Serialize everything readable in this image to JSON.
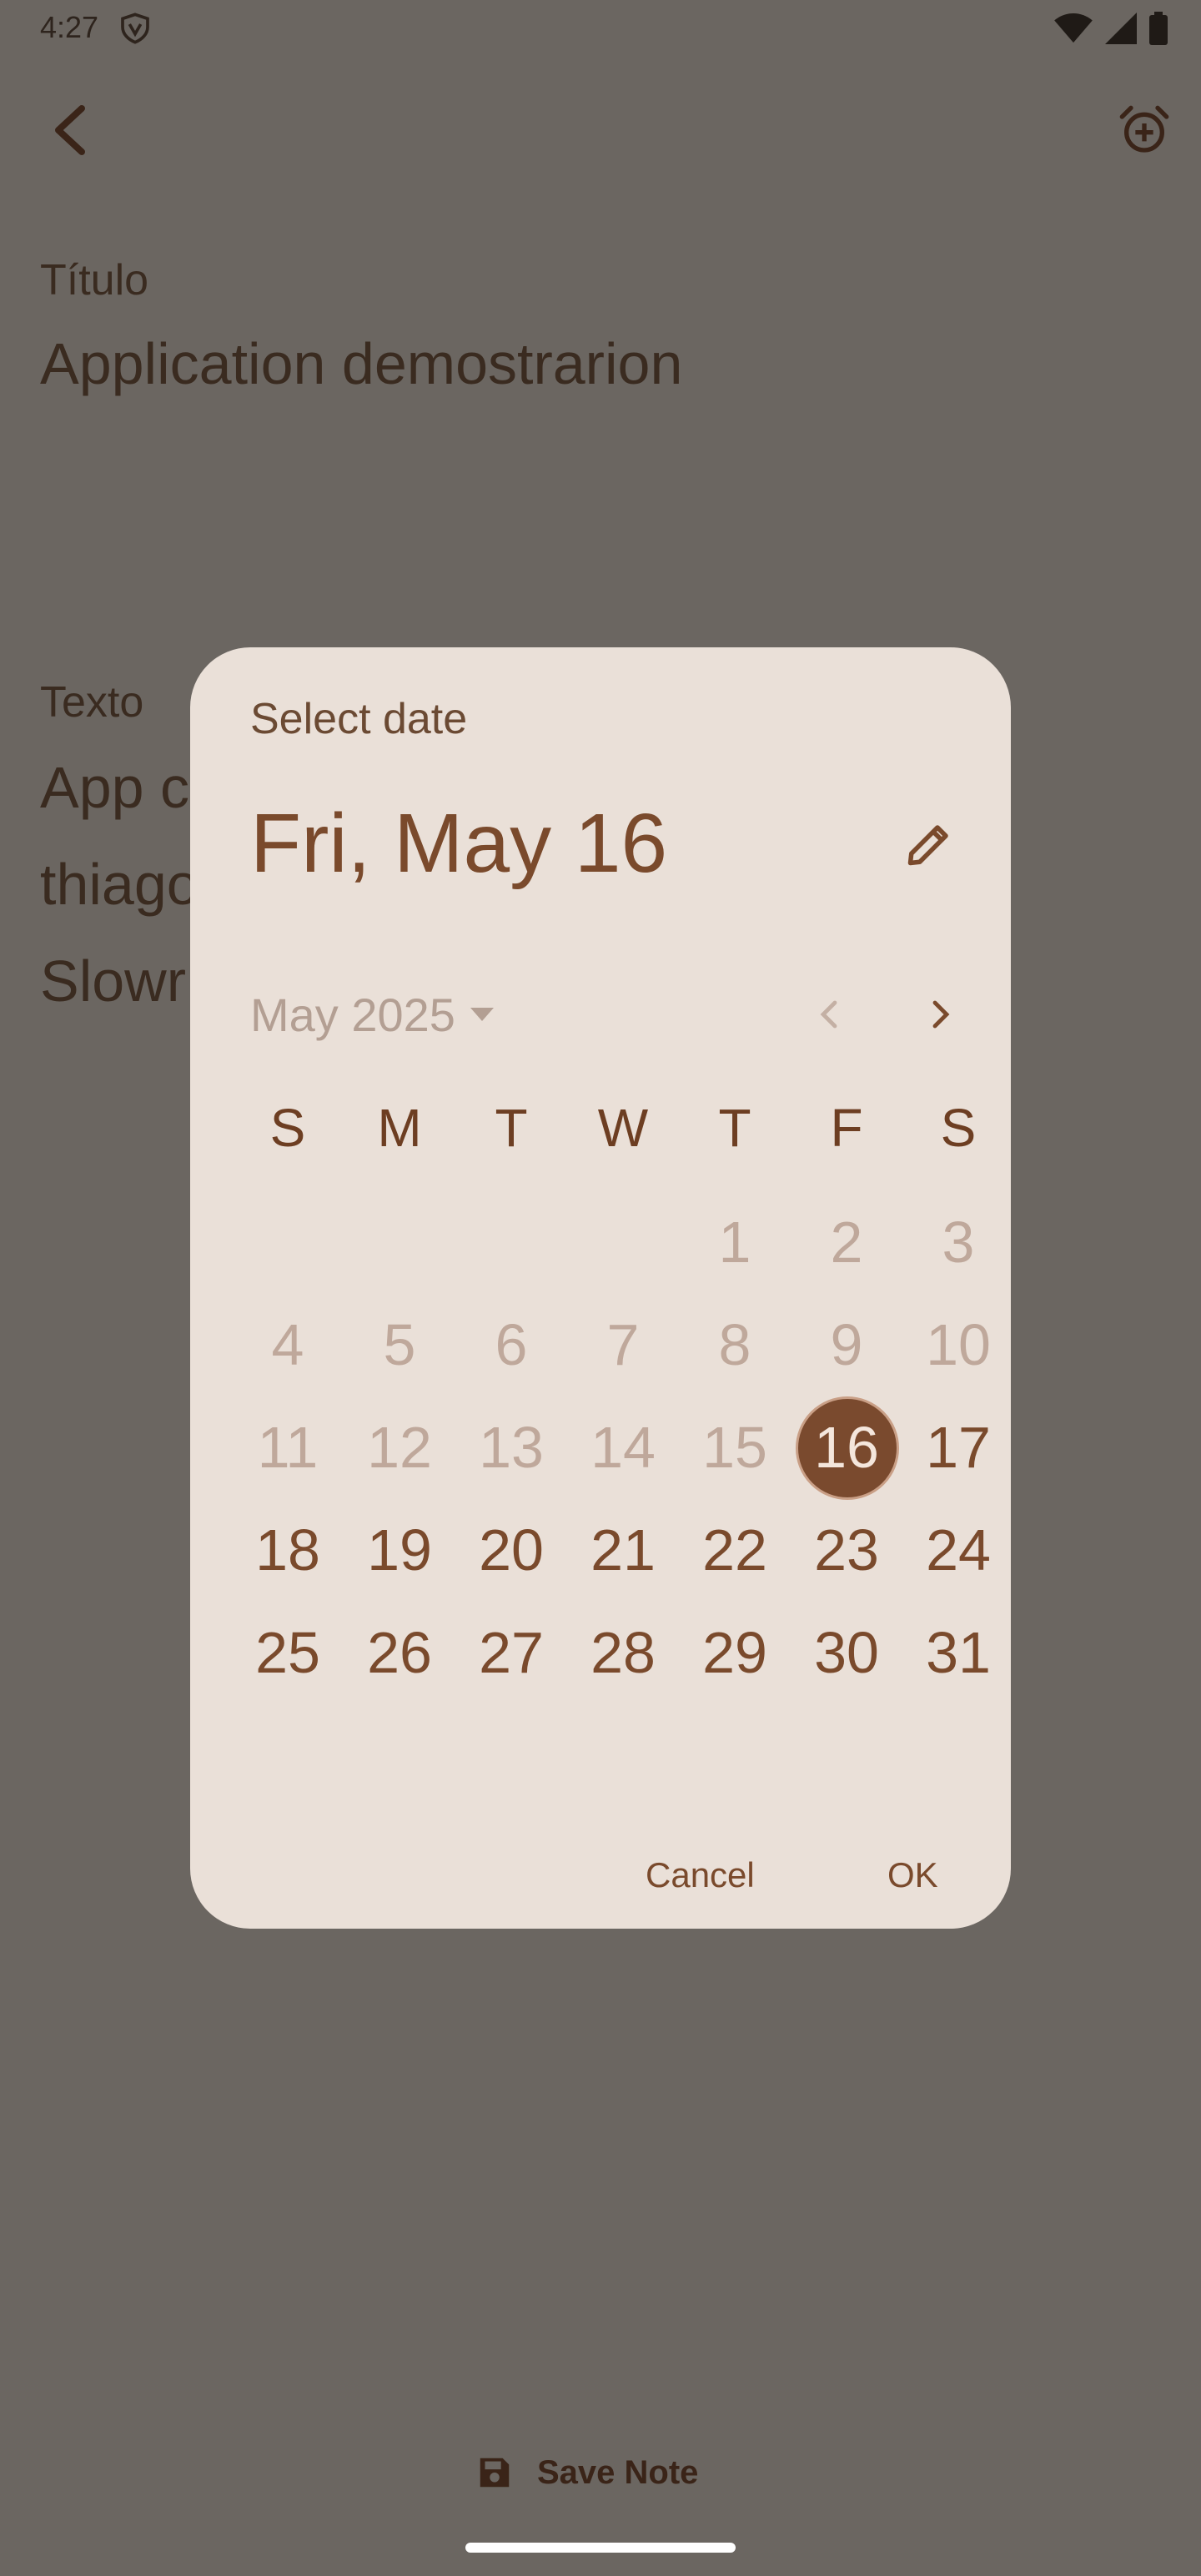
{
  "status_bar": {
    "time": "4:27",
    "icons": [
      "vpn-icon",
      "wifi-icon",
      "cell-signal-icon",
      "battery-icon"
    ]
  },
  "app_bar": {
    "back_icon": "chevron-left-icon",
    "alarm_icon": "alarm-add-icon"
  },
  "note": {
    "title_label": "Título",
    "title_value": "Application demostrarion",
    "body_label": "Texto",
    "body_value": "App c\nthiago\nSlowr"
  },
  "date_picker": {
    "heading": "Select date",
    "selected_date": "Fri, May 16",
    "edit_icon": "pencil-icon",
    "month_year": "May 2025",
    "weekdays": [
      "S",
      "M",
      "T",
      "W",
      "T",
      "F",
      "S"
    ],
    "leading_blanks": 4,
    "days": [
      "1",
      "2",
      "3",
      "4",
      "5",
      "6",
      "7",
      "8",
      "9",
      "10",
      "11",
      "12",
      "13",
      "14",
      "15",
      "16",
      "17",
      "18",
      "19",
      "20",
      "21",
      "22",
      "23",
      "24",
      "25",
      "26",
      "27",
      "28",
      "29",
      "30",
      "31"
    ],
    "faded_through": 15,
    "selected_day": "16",
    "cancel_label": "Cancel",
    "ok_label": "OK"
  },
  "bottom": {
    "save_label": "Save Note",
    "save_icon": "save-icon"
  },
  "colors": {
    "scrim": "#6b6661",
    "dialog_bg": "#eae0d8",
    "accent": "#7a4a2e",
    "faded_text": "#bfa89b"
  }
}
